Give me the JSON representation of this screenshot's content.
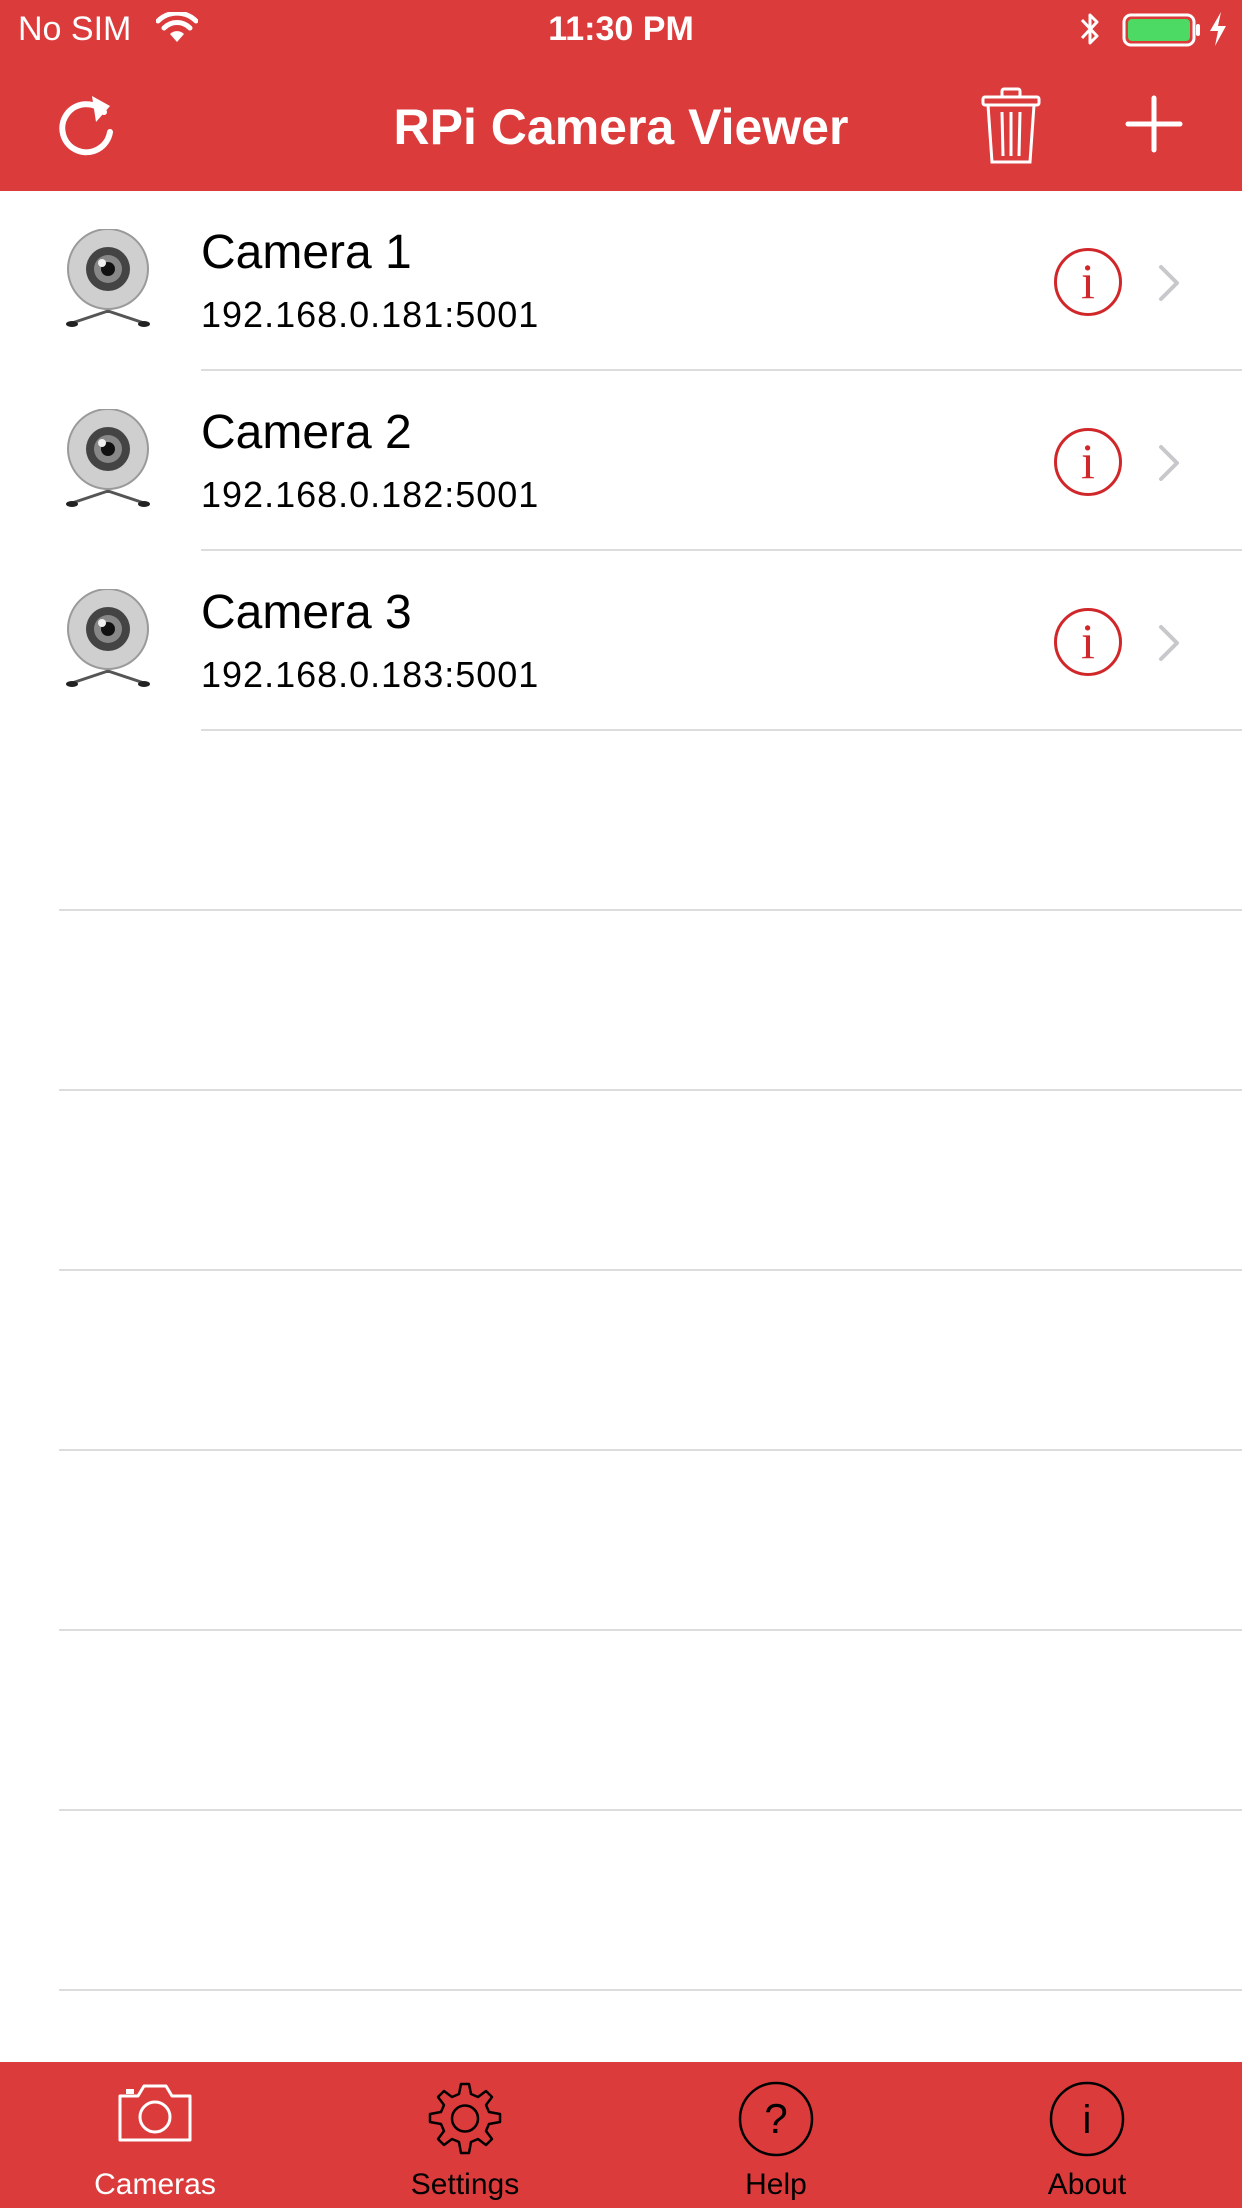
{
  "status_bar": {
    "carrier": "No SIM",
    "time": "11:30 PM"
  },
  "nav": {
    "title": "RPi Camera Viewer"
  },
  "cameras": [
    {
      "name": "Camera 1",
      "address": "192.168.0.181:5001",
      "info_label": "i"
    },
    {
      "name": "Camera 2",
      "address": "192.168.0.182:5001",
      "info_label": "i"
    },
    {
      "name": "Camera 3",
      "address": "192.168.0.183:5001",
      "info_label": "i"
    }
  ],
  "tabs": [
    {
      "label": "Cameras",
      "icon": "camera-icon",
      "active": true
    },
    {
      "label": "Settings",
      "icon": "gear-icon",
      "active": false
    },
    {
      "label": "Help",
      "icon": "help-icon",
      "active": false
    },
    {
      "label": "About",
      "icon": "info-icon",
      "active": false
    }
  ],
  "colors": {
    "accent": "#dc3b3c",
    "info": "#d0282a",
    "battery": "#4cd964"
  }
}
